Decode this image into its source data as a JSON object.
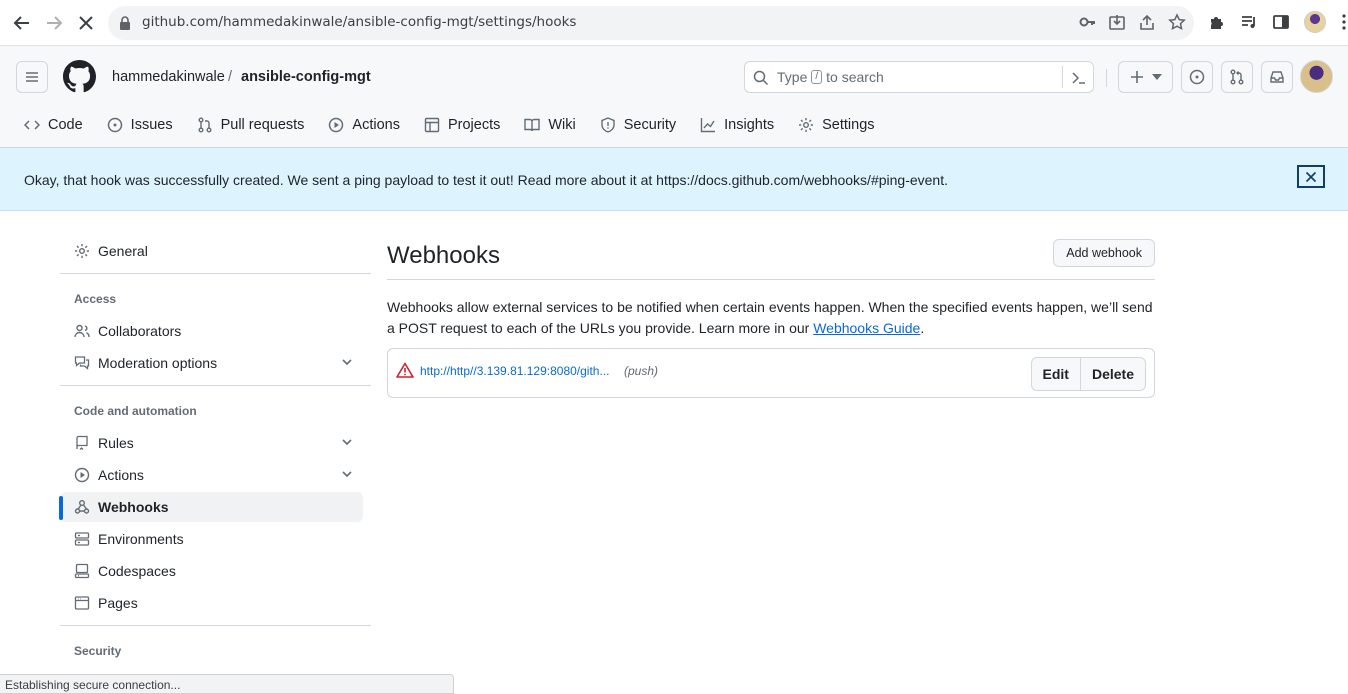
{
  "browser": {
    "url": "github.com/hammedakinwale/ansible-config-mgt/settings/hooks"
  },
  "header": {
    "owner": "hammedakinwale",
    "separator": "/",
    "repo": "ansible-config-mgt",
    "search_prefix": "Type",
    "search_key": "/",
    "search_suffix": "to search"
  },
  "tabs": [
    {
      "label": "Code",
      "icon": "code-icon"
    },
    {
      "label": "Issues",
      "icon": "issue-icon"
    },
    {
      "label": "Pull requests",
      "icon": "pull-request-icon"
    },
    {
      "label": "Actions",
      "icon": "play-icon"
    },
    {
      "label": "Projects",
      "icon": "table-icon"
    },
    {
      "label": "Wiki",
      "icon": "book-icon"
    },
    {
      "label": "Security",
      "icon": "shield-icon"
    },
    {
      "label": "Insights",
      "icon": "graph-icon"
    },
    {
      "label": "Settings",
      "icon": "gear-icon"
    }
  ],
  "flash": {
    "message": "Okay, that hook was successfully created. We sent a ping payload to test it out! Read more about it at https://docs.github.com/webhooks/#ping-event."
  },
  "sidebar": {
    "general": "General",
    "access_heading": "Access",
    "collaborators": "Collaborators",
    "moderation": "Moderation options",
    "code_heading": "Code and automation",
    "rules": "Rules",
    "actions": "Actions",
    "webhooks": "Webhooks",
    "environments": "Environments",
    "codespaces": "Codespaces",
    "pages": "Pages",
    "security_heading": "Security"
  },
  "main": {
    "title": "Webhooks",
    "add_button": "Add webhook",
    "description": "Webhooks allow external services to be notified when certain events happen. When the specified events happen, we’ll send a POST request to each of the URLs you provide. Learn more in our",
    "guide_link": "Webhooks Guide",
    "period": ".",
    "hook": {
      "url": "http://http//3.139.81.129:8080/gith...",
      "event": "(push)",
      "edit": "Edit",
      "delete": "Delete"
    }
  },
  "status_bar": "Establishing secure connection..."
}
